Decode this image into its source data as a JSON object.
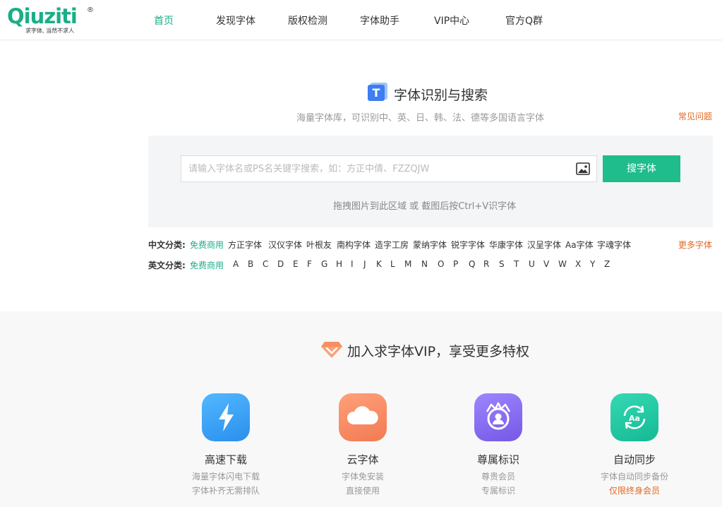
{
  "brand": {
    "logo_text": "Qiuziti",
    "registered": "®",
    "slogan": "求字体, 当然不求人"
  },
  "nav": [
    {
      "label": "首页",
      "active": true
    },
    {
      "label": "发现字体",
      "active": false
    },
    {
      "label": "版权检测",
      "active": false
    },
    {
      "label": "字体助手",
      "active": false
    },
    {
      "label": "VIP中心",
      "active": false
    },
    {
      "label": "官方Q群",
      "active": false
    }
  ],
  "search": {
    "title": "字体识别与搜索",
    "subtitle": "海量字体库，可识别中、英、日、韩、法、德等多国语言字体",
    "faq_label": "常见问题",
    "placeholder": "请输入字体名或PS名关键字搜索，如：方正中倩、FZZQJW",
    "value": "",
    "button_label": "搜字体",
    "drag_hint": "拖拽图片到此区域 或 截图后按Ctrl+V识字体"
  },
  "categories": {
    "chinese_label": "中文分类:",
    "chinese_items": [
      "免费商用",
      "方正字体",
      "汉仪字体",
      "叶根友",
      "南构字体",
      "造字工房",
      "蒙纳字体",
      "锐字字体",
      "华康字体",
      "汉呈字体",
      "Aa字体",
      "字魂字体"
    ],
    "more_label": "更多字体",
    "english_label": "英文分类:",
    "english_items": [
      "免费商用",
      "A",
      "B",
      "C",
      "D",
      "E",
      "F",
      "G",
      "H",
      "I",
      "J",
      "K",
      "L",
      "M",
      "N",
      "O",
      "P",
      "Q",
      "R",
      "S",
      "T",
      "U",
      "V",
      "W",
      "X",
      "Y",
      "Z"
    ]
  },
  "vip": {
    "title": "加入求字体VIP，享受更多特权",
    "features": [
      {
        "name": "高速下载",
        "desc1": "海量字体闪电下载",
        "desc2": "字体补齐无需排队",
        "icon": "lightning-icon",
        "color": "#3aa4f2"
      },
      {
        "name": "云字体",
        "desc1": "字体免安装",
        "desc2": "直接使用",
        "icon": "cloud-icon",
        "color": "#f5885f"
      },
      {
        "name": "尊属标识",
        "desc1": "尊贵会员",
        "desc2": "专属标识",
        "icon": "crown-avatar-icon",
        "color": "#8a6cf0"
      },
      {
        "name": "自动同步",
        "desc1": "字体自动同步备份",
        "desc2": "仅限终身会员",
        "icon": "sync-icon",
        "color": "#20c6a3"
      }
    ]
  },
  "colors": {
    "accent": "#1aae88",
    "button": "#1fbc8c",
    "link_orange": "#e4681f"
  }
}
